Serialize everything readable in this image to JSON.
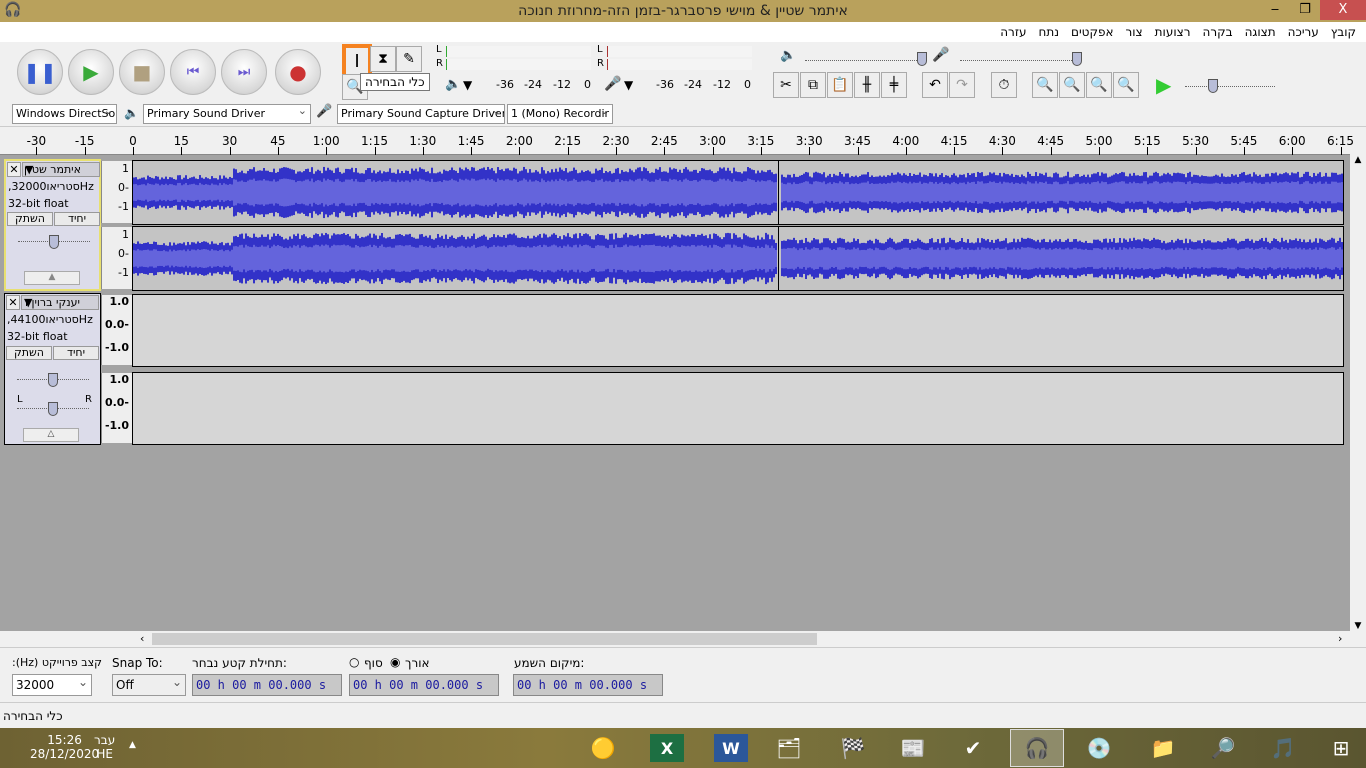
{
  "window": {
    "title": "איתמר שטיין & מוישי פרסברגר-בזמן הזה-מחרוזת חנוכה",
    "minimize": "‒",
    "restore": "❐",
    "close": "X"
  },
  "menu": [
    "קובץ",
    "עריכה",
    "תצוגה",
    "בקרה",
    "רצועות",
    "צור",
    "אפקטים",
    "נתח",
    "עזרה"
  ],
  "tools": {
    "selection_tooltip": "כלי הבחירה"
  },
  "meters": {
    "play_label_L": "L",
    "play_label_R": "R",
    "rec_label_L": "L",
    "rec_label_R": "R",
    "ticks": [
      "-36",
      "-24",
      "-12",
      "0"
    ]
  },
  "device": {
    "host": "Windows DirectSo",
    "playback": "Primary Sound Driver",
    "recording": "Primary Sound Capture Driver",
    "channels": "1 (Mono) Recordir"
  },
  "ruler": {
    "ticks": [
      "-30",
      "-15",
      "0",
      "15",
      "30",
      "45",
      "1:00",
      "1:15",
      "1:30",
      "1:45",
      "2:00",
      "2:15",
      "2:30",
      "2:45",
      "3:00",
      "3:15",
      "3:30",
      "3:45",
      "4:00",
      "4:15",
      "4:30",
      "4:45",
      "5:00",
      "5:15",
      "5:30",
      "5:45",
      "6:00",
      "6:15"
    ]
  },
  "tracks": [
    {
      "name": "איתמר שטיין",
      "rate": ",32000סטריאוHz",
      "format": "32-bit float",
      "mute": "השתק",
      "solo": "יחיד",
      "scale": [
        "1",
        "0-",
        "-1"
      ],
      "selected": true
    },
    {
      "name": "יענקי ברוין ו",
      "rate": ",44100סטריאוHz",
      "format": "32-bit float",
      "mute": "השתק",
      "solo": "יחיד",
      "scale": [
        "1.0",
        "0.0-",
        "-1.0"
      ],
      "selected": false,
      "pan_L": "L",
      "pan_R": "R"
    }
  ],
  "colors": {
    "waveform": "#3232c8",
    "waveform_rms": "#6464dc",
    "tool_highlight": "#f58220"
  },
  "selection": {
    "rate_label": "קצב פרוייקט (Hz):",
    "rate": "32000",
    "snap_label": "Snap To:",
    "snap": "Off",
    "start_label": "תחילת קטע נבחר:",
    "end_label": "סוף",
    "length_label": "אורך",
    "length_selected": true,
    "audio_pos_label": "מיקום השמע:",
    "start": "00 h 00 m 00.000 s",
    "end": "00 h 00 m 00.000 s",
    "audio_pos": "00 h 00 m 00.000 s"
  },
  "status": "כלי הבחירה",
  "taskbar": {
    "time": "15:26",
    "date": "28/12/2020",
    "lang": "עבר",
    "lang_code": "HE"
  }
}
